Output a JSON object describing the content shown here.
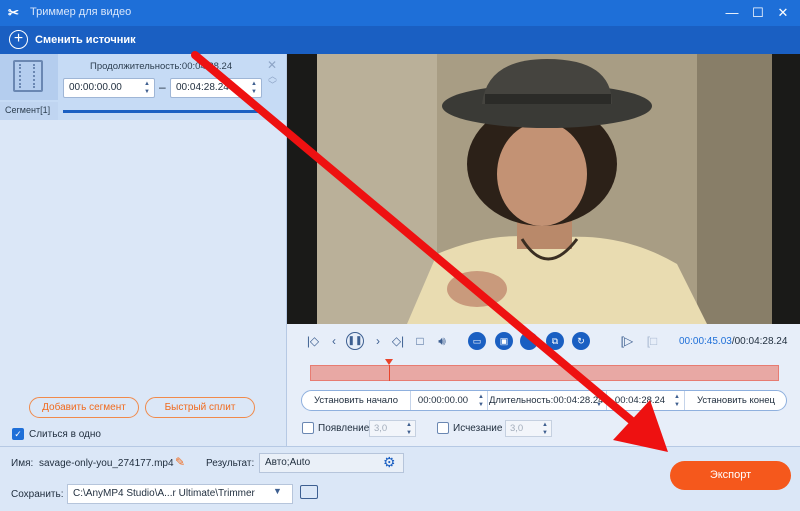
{
  "window": {
    "title": "Триммер для видео",
    "logo_glyph": "✂",
    "minimize_glyph": "—",
    "maximize_glyph": "☐",
    "close_glyph": "✕"
  },
  "toolbar": {
    "change_source_label": "Сменить источник"
  },
  "segment": {
    "duration_label": "Продолжительность:00:04:28.24",
    "start_time": "00:00:00.00",
    "end_time": "00:04:28.24",
    "separator": "–",
    "tab_label": "Сегмент[1]"
  },
  "left_actions": {
    "add_segment_label": "Добавить сегмент",
    "fast_split_label": "Быстрый сплит",
    "merge_label": "Слиться в одно",
    "merge_checked": true
  },
  "player": {
    "current_time": "00:00:45.03",
    "total_time": "/00:04:28.24",
    "playhead_fraction": 0.168
  },
  "trim": {
    "set_start_label": "Установить начало",
    "start_value": "00:00:00.00",
    "duration_label": "Длительность:00:04:28.24",
    "end_value": "00:04:28.24",
    "set_end_label": "Установить конец"
  },
  "fade": {
    "fade_in_label": "Появление",
    "fade_in_value": "3,0",
    "fade_out_label": "Исчезание",
    "fade_out_value": "3,0"
  },
  "output": {
    "name_label": "Имя:",
    "file_name": "savage-only-you_274177.mp4",
    "result_label": "Результат:",
    "result_value": "Авто;Auto",
    "save_label": "Сохранить:",
    "save_path": "C:\\AnyMP4 Studio\\A...r Ultimate\\Trimmer",
    "export_label": "Экспорт"
  },
  "colors": {
    "accent": "#1e6fd8",
    "export": "#f5581c",
    "annotation_arrow": "#ee1111"
  },
  "icons": [
    "scissors-icon",
    "plus-circle-icon",
    "film-icon",
    "pause-icon",
    "volume-icon",
    "gear-icon",
    "folder-icon",
    "pencil-icon"
  ]
}
